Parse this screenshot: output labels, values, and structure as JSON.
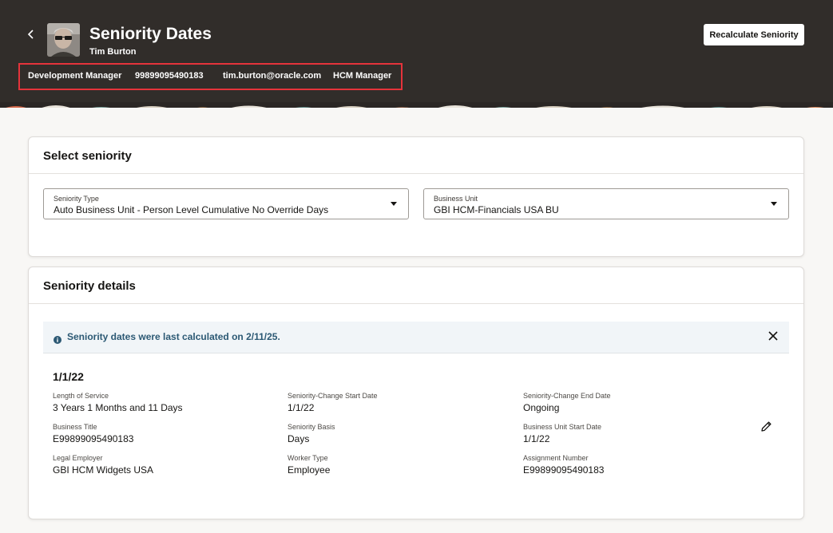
{
  "header": {
    "title": "Seniority Dates",
    "person_name": "Tim Burton",
    "recalculate_label": "Recalculate Seniority",
    "meta": {
      "business_title": "Development Manager",
      "person_number": "99899095490183",
      "email": "tim.burton@oracle.com",
      "role": "HCM Manager"
    }
  },
  "select_card": {
    "title": "Select seniority",
    "seniority_type": {
      "label": "Seniority Type",
      "value": "Auto Business Unit - Person Level Cumulative No Override Days"
    },
    "business_unit": {
      "label": "Business Unit",
      "value": "GBI HCM-Financials USA BU"
    }
  },
  "details_card": {
    "title": "Seniority details",
    "info_message": "Seniority dates were last calculated on 2/11/25.",
    "date": "1/1/22",
    "fields": [
      {
        "label": "Length of Service",
        "value": "3 Years 1 Months and 11 Days"
      },
      {
        "label": "Seniority-Change Start Date",
        "value": "1/1/22"
      },
      {
        "label": "Seniority-Change End Date",
        "value": "Ongoing"
      },
      {
        "label": "Business Title",
        "value": "E99899095490183"
      },
      {
        "label": "Seniority Basis",
        "value": "Days"
      },
      {
        "label": "Business Unit Start Date",
        "value": "1/1/22"
      },
      {
        "label": "Legal Employer",
        "value": "GBI HCM Widgets USA"
      },
      {
        "label": "Worker Type",
        "value": "Employee"
      },
      {
        "label": "Assignment Number",
        "value": "E99899095490183"
      }
    ]
  },
  "icons": {
    "back": "chevron-left-icon",
    "info": "info-icon",
    "close": "close-icon",
    "edit": "pencil-icon"
  },
  "colors": {
    "header_bg": "#312d2a",
    "highlight_border": "#e5333b",
    "info_text": "#2c5974",
    "info_bg": "#f1f5f8"
  }
}
